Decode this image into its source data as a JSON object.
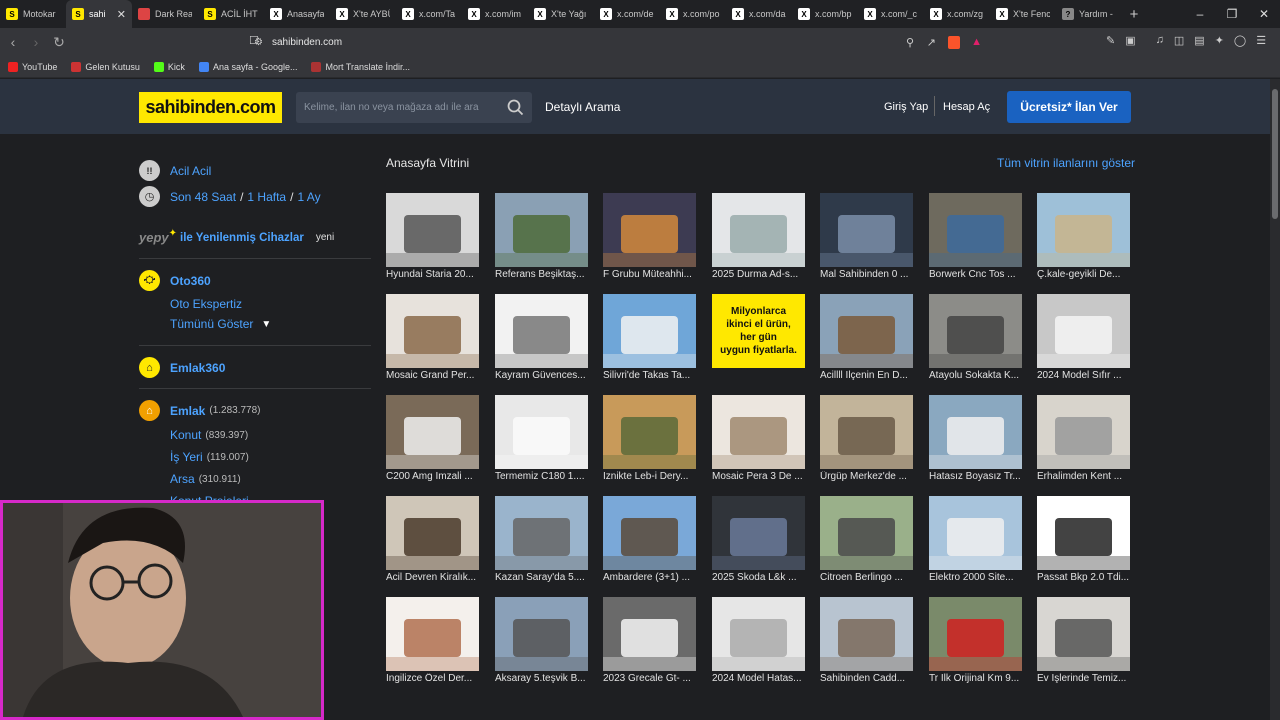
{
  "browser": {
    "tabs": [
      {
        "title": "Motokar",
        "color": "#ffe800",
        "glyph": "S"
      },
      {
        "title": "sahi",
        "color": "#ffe800",
        "glyph": "S",
        "active": true
      },
      {
        "title": "Dark Rea",
        "color": "#d44",
        "glyph": ""
      },
      {
        "title": "ACİL İHT",
        "color": "#ffe800",
        "glyph": "S"
      },
      {
        "title": "Anasayfa",
        "color": "#fff",
        "glyph": "X"
      },
      {
        "title": "X'te AYBÜ",
        "color": "#fff",
        "glyph": "X"
      },
      {
        "title": "x.com/Ta",
        "color": "#fff",
        "glyph": "X"
      },
      {
        "title": "x.com/im",
        "color": "#fff",
        "glyph": "X"
      },
      {
        "title": "X'te Yağı",
        "color": "#fff",
        "glyph": "X"
      },
      {
        "title": "x.com/de",
        "color": "#fff",
        "glyph": "X"
      },
      {
        "title": "x.com/po",
        "color": "#fff",
        "glyph": "X"
      },
      {
        "title": "x.com/da",
        "color": "#fff",
        "glyph": "X"
      },
      {
        "title": "x.com/bp",
        "color": "#fff",
        "glyph": "X"
      },
      {
        "title": "x.com/_c",
        "color": "#fff",
        "glyph": "X"
      },
      {
        "title": "x.com/zg",
        "color": "#fff",
        "glyph": "X"
      },
      {
        "title": "X'te Fenc",
        "color": "#fff",
        "glyph": "X"
      },
      {
        "title": "Yardım -",
        "color": "#888",
        "glyph": "?"
      }
    ],
    "new_tab": "+",
    "url": "sahibinden.com",
    "bookmarks": [
      {
        "label": "YouTube",
        "color": "#e22"
      },
      {
        "label": "Gelen Kutusu",
        "color": "#c33"
      },
      {
        "label": "Kick",
        "color": "#53fc18"
      },
      {
        "label": "Ana sayfa - Google...",
        "color": "#4285f4"
      },
      {
        "label": "Mort Translate İndir...",
        "color": "#a33"
      }
    ]
  },
  "header": {
    "logo": "sahibinden.com",
    "search_placeholder": "Kelime, ilan no veya mağaza adı ile ara",
    "detailed_search": "Detaylı Arama",
    "login": "Giriş Yap",
    "register": "Hesap Aç",
    "post_ad": "Ücretsiz* İlan Ver"
  },
  "sidebar": {
    "acil": "Acil Acil",
    "son48": "Son 48 Saat",
    "slash": "/",
    "hafta": "1 Hafta",
    "ay": "1 Ay",
    "yepy_logo": "yepy",
    "yepy": "ile Yenilenmiş Cihazlar",
    "yepy_badge": "yeni",
    "oto360": "Oto360",
    "oto_ekspertiz": "Oto Ekspertiz",
    "tumunu": "Tümünü Göster",
    "emlak360": "Emlak360",
    "emlak": "Emlak",
    "emlak_count": "(1.283.778)",
    "konut": "Konut",
    "konut_count": "(839.397)",
    "isyeri": "İş Yeri",
    "isyeri_count": "(119.007)",
    "arsa": "Arsa",
    "arsa_count": "(310.911)",
    "konut_projeleri": "Konut Projeleri"
  },
  "vitrin": {
    "title": "Anasayfa Vitrini",
    "all_link": "Tüm vitrin ilanlarını göster",
    "ad_lines": [
      "Milyonlarca",
      "ikinci el ürün,",
      "her gün",
      "uygun fiyatlarla."
    ],
    "items": [
      {
        "caption": "Hyundai Staria 20...",
        "bg": "#d9d9d9",
        "fg": "#555"
      },
      {
        "caption": "Referans Beşiktaş...",
        "bg": "#8aa0b4",
        "fg": "#4d6b3a"
      },
      {
        "caption": "F Grubu Müteahhi...",
        "bg": "#3d3b52",
        "fg": "#d28a3c"
      },
      {
        "caption": "2025 Durma Ad-s...",
        "bg": "#e4e6e8",
        "fg": "#9aa"
      },
      {
        "caption": "Mal Sahibinden 0 ...",
        "bg": "#2f3a4a",
        "fg": "#7a8ea8"
      },
      {
        "caption": "Borwerk Cnc Tos ...",
        "bg": "#6e6a5e",
        "fg": "#3d6a9c"
      },
      {
        "caption": "Ç.kale-geyikli De...",
        "bg": "#9ec0d8",
        "fg": "#c9b48a"
      },
      {
        "caption": "Mosaic Grand Per...",
        "bg": "#e7e2dc",
        "fg": "#8a6a4a"
      },
      {
        "caption": "Kayram Güvences...",
        "bg": "#f2f2f2",
        "fg": "#777"
      },
      {
        "caption": "Silivri'de Takas Ta...",
        "bg": "#6fa6d8",
        "fg": "#f2f2f2"
      },
      {
        "caption": "",
        "ad": true
      },
      {
        "caption": "Acillll Ilçenin En D...",
        "bg": "#8aa2b8",
        "fg": "#7a5a3a"
      },
      {
        "caption": "Atayolu Sokakta K...",
        "bg": "#8c8c88",
        "fg": "#444"
      },
      {
        "caption": "2024 Model Sıfır ...",
        "bg": "#c8c8c8",
        "fg": "#f5f5f5"
      },
      {
        "caption": "C200 Amg Imzali ...",
        "bg": "#7a6a58",
        "fg": "#f0f0f0"
      },
      {
        "caption": "Termemiz C180 1....",
        "bg": "#e8e8e8",
        "fg": "#fafafa"
      },
      {
        "caption": "Iznikte Leb-i Dery...",
        "bg": "#c89a5a",
        "fg": "#5a6a3a"
      },
      {
        "caption": "Mosaic Pera 3 De ...",
        "bg": "#ece6df",
        "fg": "#a08870"
      },
      {
        "caption": "Ürgüp Merkez'de ...",
        "bg": "#c2b49a",
        "fg": "#6a5a48"
      },
      {
        "caption": "Hatasız Boyasız Tr...",
        "bg": "#8aa8c0",
        "fg": "#f0f0f0"
      },
      {
        "caption": "Erhalimden Kent ...",
        "bg": "#d8d4cc",
        "fg": "#999"
      },
      {
        "caption": "Acil Devren Kiralık...",
        "bg": "#cfc6b8",
        "fg": "#4a3a2a"
      },
      {
        "caption": "Kazan Saray'da 5....",
        "bg": "#9ab4cc",
        "fg": "#666"
      },
      {
        "caption": "Ambardere (3+1) ...",
        "bg": "#7aa8d8",
        "fg": "#5a4a3a"
      },
      {
        "caption": "2025 Skoda L&k ...",
        "bg": "#30343a",
        "fg": "#6a7a9a"
      },
      {
        "caption": "Citroen Berlingo ...",
        "bg": "#9ab08a",
        "fg": "#4a4a4a"
      },
      {
        "caption": "Elektro 2000 Site...",
        "bg": "#a8c4dc",
        "fg": "#f0f0f0"
      },
      {
        "caption": "Passat Bkp 2.0 Tdi...",
        "bg": "#ffffff",
        "fg": "#222"
      },
      {
        "caption": "Ingilizce Özel Der...",
        "bg": "#f4f0ec",
        "fg": "#b07050"
      },
      {
        "caption": "Aksaray 5.teşvik B...",
        "bg": "#8aa0b8",
        "fg": "#555"
      },
      {
        "caption": "2023 Grecale Gt- ...",
        "bg": "#6a6a6a",
        "fg": "#f5f5f5"
      },
      {
        "caption": "2024 Model Hatas...",
        "bg": "#e6e6e6",
        "fg": "#aaa"
      },
      {
        "caption": "Sahibinden Cadd...",
        "bg": "#b8c4d0",
        "fg": "#7a6a5a"
      },
      {
        "caption": "Tr Ilk Orijinal Km 9...",
        "bg": "#7a8a6a",
        "fg": "#d02020"
      },
      {
        "caption": "Ev Işlerinde Temiz...",
        "bg": "#d8d6d2",
        "fg": "#555"
      }
    ]
  }
}
